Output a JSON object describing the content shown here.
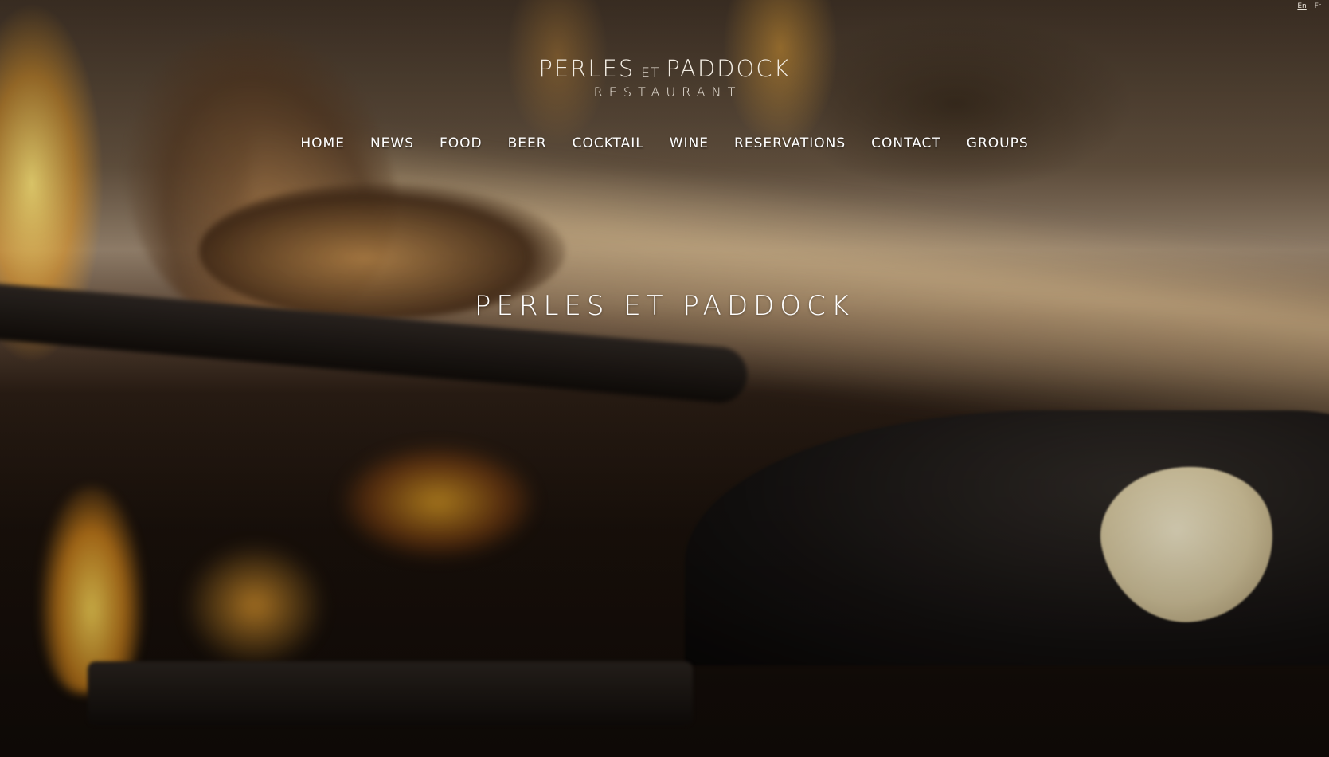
{
  "language_switch": {
    "items": [
      "En",
      "Fr"
    ],
    "active": "En"
  },
  "logo": {
    "line1_left": "PERLES",
    "line1_mid": "ET",
    "line1_right": "PADDOCK",
    "line2": "RESTAURANT"
  },
  "nav": {
    "items": [
      "HOME",
      "NEWS",
      "FOOD",
      "BEER",
      "COCKTAIL",
      "WINE",
      "RESERVATIONS",
      "CONTACT",
      "GROUPS"
    ]
  },
  "hero": {
    "headline": "PERLES ET PADDOCK"
  }
}
